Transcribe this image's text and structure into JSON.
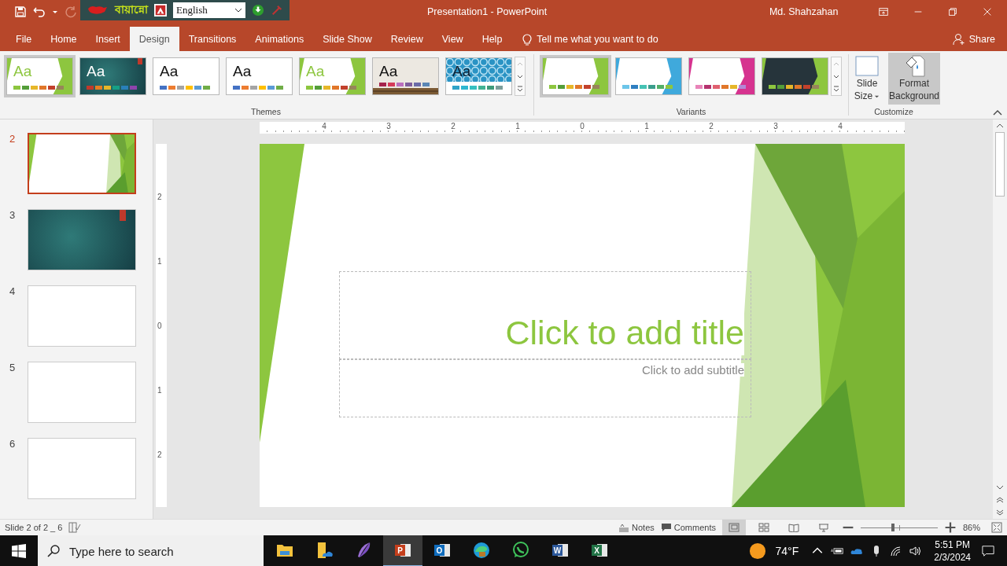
{
  "title_bar": {
    "title": "Presentation1  -  PowerPoint",
    "user": "Md. Shahzahan"
  },
  "addon_bar": {
    "bengali_label": "বায়ান্নো",
    "language": "English"
  },
  "tabs": [
    {
      "label": "File",
      "selected": false
    },
    {
      "label": "Home",
      "selected": false
    },
    {
      "label": "Insert",
      "selected": false
    },
    {
      "label": "Design",
      "selected": true
    },
    {
      "label": "Transitions",
      "selected": false
    },
    {
      "label": "Animations",
      "selected": false
    },
    {
      "label": "Slide Show",
      "selected": false
    },
    {
      "label": "Review",
      "selected": false
    },
    {
      "label": "View",
      "selected": false
    },
    {
      "label": "Help",
      "selected": false
    }
  ],
  "tell_me": "Tell me what you want to do",
  "share": "Share",
  "themes": {
    "label": "Themes",
    "items": [
      {
        "kind": "facet",
        "sample": "Aa",
        "selected": true,
        "swatches": [
          {
            "color": "#8dc63f"
          },
          {
            "color": "#549e39"
          },
          {
            "color": "#e6b729"
          },
          {
            "color": "#e1772a"
          },
          {
            "color": "#c2412c"
          },
          {
            "color": "#97855a"
          }
        ]
      },
      {
        "kind": "dark",
        "sample": "Aa",
        "selected": false,
        "swatches": [
          {
            "color": "#c0392b"
          },
          {
            "color": "#e67e22"
          },
          {
            "color": "#e6b729"
          },
          {
            "color": "#16a085"
          },
          {
            "color": "#2980b9"
          },
          {
            "color": "#8e44ad"
          }
        ]
      },
      {
        "kind": "plain",
        "sample": "Aa",
        "selected": false,
        "swatches": [
          {
            "color": "#4472c4"
          },
          {
            "color": "#ed7d31"
          },
          {
            "color": "#a5a5a5"
          },
          {
            "color": "#ffc000"
          },
          {
            "color": "#5b9bd5"
          },
          {
            "color": "#70ad47"
          }
        ]
      },
      {
        "kind": "plain",
        "sample": "Aa",
        "selected": false,
        "swatches": [
          {
            "color": "#4472c4"
          },
          {
            "color": "#ed7d31"
          },
          {
            "color": "#a5a5a5"
          },
          {
            "color": "#ffc000"
          },
          {
            "color": "#5b9bd5"
          },
          {
            "color": "#70ad47"
          }
        ]
      },
      {
        "kind": "facet",
        "sample": "Aa",
        "selected": false,
        "swatches": [
          {
            "color": "#8dc63f"
          },
          {
            "color": "#549e39"
          },
          {
            "color": "#e6b729"
          },
          {
            "color": "#e1772a"
          },
          {
            "color": "#c2412c"
          },
          {
            "color": "#97855a"
          }
        ]
      },
      {
        "kind": "wood",
        "sample": "Aa",
        "selected": false,
        "swatches": [
          {
            "color": "#a5234b"
          },
          {
            "color": "#d53b58"
          },
          {
            "color": "#bb6fbd"
          },
          {
            "color": "#7e5e9c"
          },
          {
            "color": "#6b6ba8"
          },
          {
            "color": "#5b87b5"
          }
        ]
      },
      {
        "kind": "pattern",
        "sample": "Aa",
        "selected": false,
        "swatches": [
          {
            "color": "#2fa3c8"
          },
          {
            "color": "#2fb7d0"
          },
          {
            "color": "#36c0c0"
          },
          {
            "color": "#42b393"
          },
          {
            "color": "#3f9b7a"
          },
          {
            "color": "#7d9e9a"
          }
        ]
      }
    ]
  },
  "variants": {
    "label": "Variants",
    "items": [
      {
        "selected": true,
        "dark": false,
        "color": "#8dc63f",
        "swatches": [
          {
            "color": "#8dc63f"
          },
          {
            "color": "#549e39"
          },
          {
            "color": "#e6b729"
          },
          {
            "color": "#e1772a"
          },
          {
            "color": "#c2412c"
          },
          {
            "color": "#97855a"
          }
        ]
      },
      {
        "selected": false,
        "dark": false,
        "color": "#3fa9dc",
        "swatches": [
          {
            "color": "#6cc5e9"
          },
          {
            "color": "#2f7fc1"
          },
          {
            "color": "#46c2b4"
          },
          {
            "color": "#3a9e8c"
          },
          {
            "color": "#53b069"
          },
          {
            "color": "#8dc63f"
          }
        ]
      },
      {
        "selected": false,
        "dark": false,
        "color": "#d6338f",
        "swatches": [
          {
            "color": "#e884b9"
          },
          {
            "color": "#b5326e"
          },
          {
            "color": "#e06070"
          },
          {
            "color": "#e1772a"
          },
          {
            "color": "#e6b729"
          },
          {
            "color": "#b388d6"
          }
        ]
      },
      {
        "selected": false,
        "dark": true,
        "color": "#8dc63f",
        "swatches": [
          {
            "color": "#8dc63f"
          },
          {
            "color": "#549e39"
          },
          {
            "color": "#e6b729"
          },
          {
            "color": "#e1772a"
          },
          {
            "color": "#c2412c"
          },
          {
            "color": "#97855a"
          }
        ]
      }
    ]
  },
  "customize": {
    "label": "Customize",
    "buttons": [
      {
        "kind": "slide_size",
        "label": "Slide Size",
        "hovered": false
      },
      {
        "kind": "format_background",
        "label": "Format Background",
        "hovered": true
      }
    ]
  },
  "ruler": {
    "horizontal": [
      "4",
      "3",
      "2",
      "1",
      "0",
      "1",
      "2",
      "3",
      "4"
    ],
    "vertical": [
      "2",
      "1",
      "0",
      "1",
      "2"
    ]
  },
  "slides": [
    {
      "number": "2",
      "kind": "facet",
      "selected": true
    },
    {
      "number": "3",
      "kind": "dark",
      "selected": false
    },
    {
      "number": "4",
      "kind": "blank",
      "selected": false
    },
    {
      "number": "5",
      "kind": "blank",
      "selected": false
    },
    {
      "number": "6",
      "kind": "blank",
      "selected": false
    }
  ],
  "slide": {
    "title_placeholder": "Click to add title",
    "subtitle_placeholder": "Click to add subtitle"
  },
  "status_bar": {
    "slide_info": "Slide 2 of 2 _ 6",
    "notes": "Notes",
    "comments": "Comments",
    "views": [
      {
        "kind": "normal",
        "selected": true
      },
      {
        "kind": "sorter",
        "selected": false
      },
      {
        "kind": "reading",
        "selected": false
      },
      {
        "kind": "slideshow",
        "selected": false
      }
    ],
    "zoom": {
      "level": 0.42,
      "reading": "86%"
    }
  },
  "taskbar": {
    "search_placeholder": "Type here to search",
    "apps": [
      {
        "kind": "explorer",
        "selected": false
      },
      {
        "kind": "files",
        "selected": false
      },
      {
        "kind": "feather",
        "selected": false
      },
      {
        "kind": "letter",
        "letter": "P",
        "color": "#c43e1c",
        "selected": true
      },
      {
        "kind": "letter",
        "letter": "O",
        "color": "#0f6cbd",
        "selected": false
      },
      {
        "kind": "edge",
        "selected": false
      },
      {
        "kind": "whatsapp",
        "selected": false
      },
      {
        "kind": "letter",
        "letter": "W",
        "color": "#2b579a",
        "selected": false
      },
      {
        "kind": "letter",
        "letter": "X",
        "color": "#217346",
        "selected": false
      }
    ],
    "weather": "74°F",
    "time": "5:51 PM",
    "date": "2/3/2024"
  }
}
